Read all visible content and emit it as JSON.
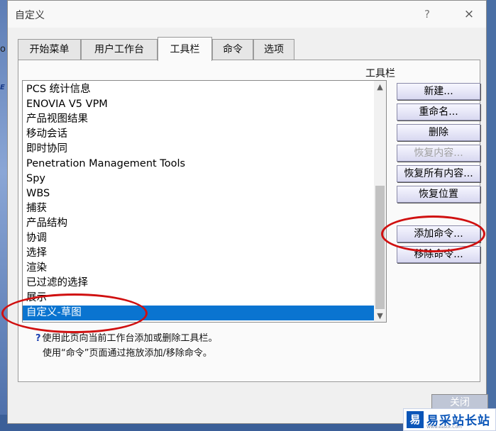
{
  "window": {
    "title": "自定义",
    "help_glyph": "?",
    "close_glyph": "×"
  },
  "background": {
    "glyph_top": "o",
    "glyph_mid": "E"
  },
  "tabs": [
    {
      "label": "开始菜单"
    },
    {
      "label": "用户工作台"
    },
    {
      "label": "工具栏",
      "active": true
    },
    {
      "label": "命令"
    },
    {
      "label": "选项"
    }
  ],
  "toolbar_list": {
    "header": "工具栏",
    "items": [
      "PCS 统计信息",
      "ENOVIA V5 VPM",
      "产品视图结果",
      "移动会话",
      "即时协同",
      "Penetration Management Tools",
      "Spy",
      "WBS",
      "捕获",
      "产品结构",
      "协调",
      "选择",
      "渲染",
      "已过滤的选择",
      "展示",
      "自定义-草图"
    ],
    "selected": "自定义-草图",
    "scroll_up": "▲",
    "scroll_down": "▼"
  },
  "buttons": {
    "new": "新建...",
    "rename": "重命名...",
    "delete": "删除",
    "restore_contents": "恢复内容...",
    "restore_all": "恢复所有内容...",
    "restore_position": "恢复位置",
    "add_commands": "添加命令...",
    "remove_commands": "移除命令..."
  },
  "help": {
    "icon": "?",
    "line1": "使用此页向当前工作台添加或删除工具栏。",
    "line2": "使用“命令”页面通过拖放添加/移除命令。"
  },
  "footer": {
    "close_label": "关闭"
  },
  "watermark": {
    "mark": "易",
    "name": "易采站长站",
    "url": "Www.easck.Com"
  },
  "colors": {
    "selection": "#0a74d0",
    "annotation": "#d01010"
  }
}
